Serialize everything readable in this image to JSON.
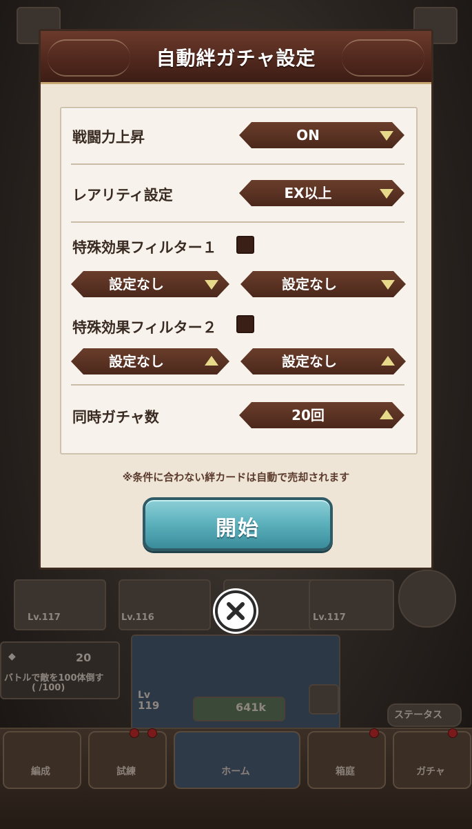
{
  "dialog": {
    "title": "自動絆ガチャ設定",
    "rows": {
      "battle_power": {
        "label": "戦闘力上昇",
        "value": "ON"
      },
      "rarity": {
        "label": "レアリティ設定",
        "value": "EX以上"
      },
      "filter1": {
        "label": "特殊効果フィルター１",
        "left": "設定なし",
        "right": "設定なし"
      },
      "filter2": {
        "label": "特殊効果フィルター２",
        "left": "設定なし",
        "right": "設定なし"
      },
      "simultaneous": {
        "label": "同時ガチャ数",
        "value": "20回"
      }
    },
    "notice": "※条件に合わない絆カードは自動で売却されます",
    "start_label": "開始"
  },
  "background": {
    "gems": "20",
    "mission_text": "バトルで敵を100体倒す",
    "mission_progress": "(     /100)",
    "level": "119",
    "power": "641k",
    "status_button": "ステータス",
    "card_levels": [
      "Lv.117",
      "Lv.116",
      "Lv.117"
    ],
    "nav": [
      "編成",
      "試練",
      "ホーム",
      "箱庭",
      "ガチャ"
    ]
  },
  "colors": {
    "header_brown": "#4f271c",
    "selector_brown": "#5a3222",
    "arrow_yellow": "#e7d98a",
    "start_teal": "#5fb3bf"
  }
}
